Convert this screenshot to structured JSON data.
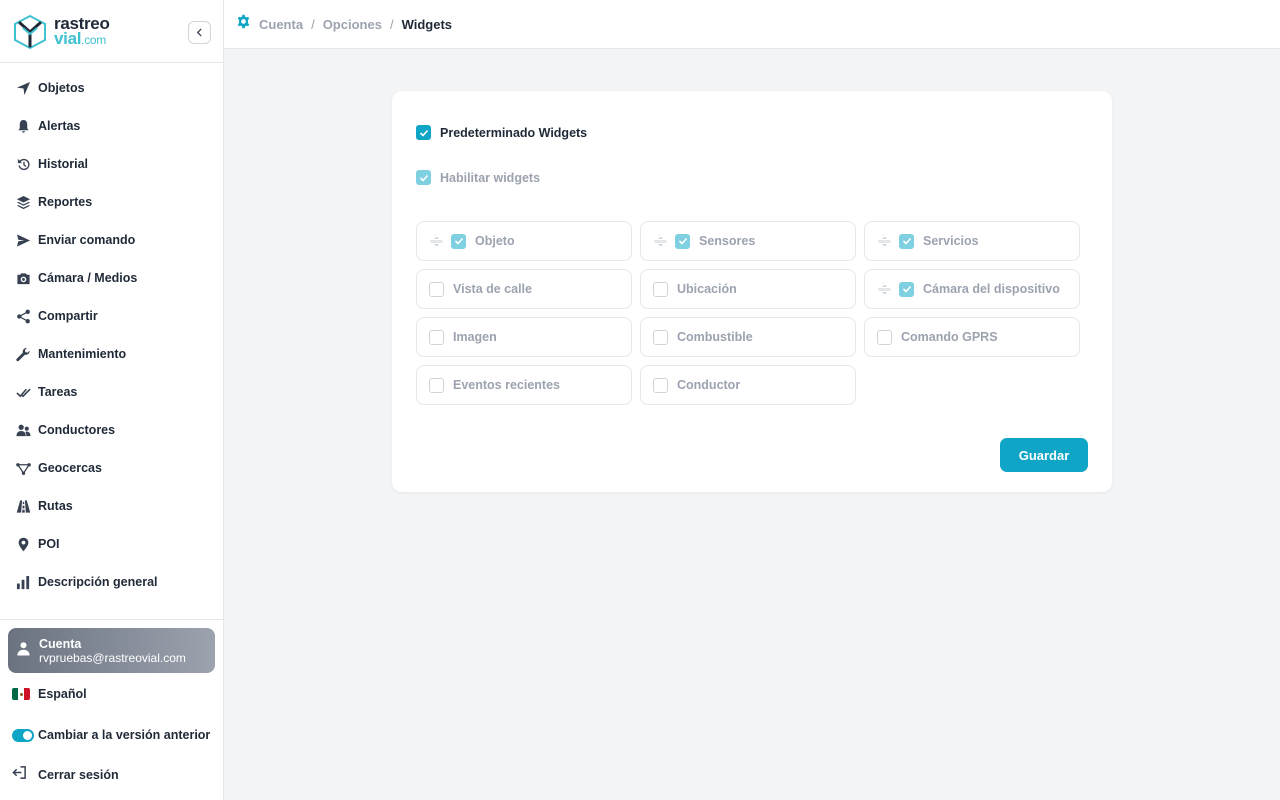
{
  "brand": {
    "line1": "rastreo",
    "line2": "vial",
    "line2_suffix": ".com",
    "accent": "#0ea5c6"
  },
  "sidebar": {
    "items": [
      {
        "label": "Objetos",
        "icon": "navigation-arrow-icon"
      },
      {
        "label": "Alertas",
        "icon": "bell-icon"
      },
      {
        "label": "Historial",
        "icon": "history-icon"
      },
      {
        "label": "Reportes",
        "icon": "layers-icon"
      },
      {
        "label": "Enviar comando",
        "icon": "send-icon"
      },
      {
        "label": "Cámara / Medios",
        "icon": "camera-icon"
      },
      {
        "label": "Compartir",
        "icon": "share-icon"
      },
      {
        "label": "Mantenimiento",
        "icon": "wrench-icon"
      },
      {
        "label": "Tareas",
        "icon": "double-check-icon"
      },
      {
        "label": "Conductores",
        "icon": "users-icon"
      },
      {
        "label": "Geocercas",
        "icon": "polygon-icon"
      },
      {
        "label": "Rutas",
        "icon": "road-icon"
      },
      {
        "label": "POI",
        "icon": "map-pin-icon"
      },
      {
        "label": "Descripción general",
        "icon": "bar-chart-icon"
      }
    ],
    "account": {
      "title": "Cuenta",
      "email": "rvpruebas@rastreovial.com"
    },
    "language": "Español",
    "switch_version": "Cambiar a la versión anterior",
    "logout": "Cerrar sesión"
  },
  "breadcrumb": {
    "items": [
      "Cuenta",
      "Opciones",
      "Widgets"
    ],
    "separator": "/"
  },
  "widgets_form": {
    "default_label": "Predeterminado Widgets",
    "default_checked": true,
    "enable_label": "Habilitar widgets",
    "enable_checked": true,
    "widgets": [
      {
        "label": "Objeto",
        "checked": true
      },
      {
        "label": "Sensores",
        "checked": true
      },
      {
        "label": "Servicios",
        "checked": true
      },
      {
        "label": "Vista de calle",
        "checked": false
      },
      {
        "label": "Ubicación",
        "checked": false
      },
      {
        "label": "Cámara del dispositivo",
        "checked": true
      },
      {
        "label": "Imagen",
        "checked": false
      },
      {
        "label": "Combustible",
        "checked": false
      },
      {
        "label": "Comando GPRS",
        "checked": false
      },
      {
        "label": "Eventos recientes",
        "checked": false
      },
      {
        "label": "Conductor",
        "checked": false
      }
    ],
    "save_label": "Guardar"
  }
}
